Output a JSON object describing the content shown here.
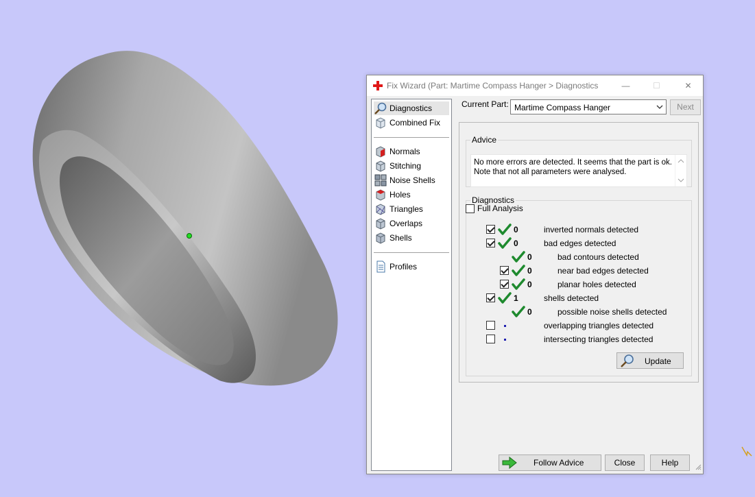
{
  "window": {
    "title": "Fix Wizard (Part: Martime Compass Hanger > Diagnostics",
    "minimize": "—",
    "maximize": "☐",
    "close": "✕"
  },
  "sidebar": {
    "items": [
      {
        "label": "Diagnostics",
        "icon": "magnifier-icon"
      },
      {
        "label": "Combined Fix",
        "icon": "cube-icon"
      },
      {
        "label": "Normals",
        "icon": "normals-cube-icon"
      },
      {
        "label": "Stitching",
        "icon": "stitching-cube-icon"
      },
      {
        "label": "Noise Shells",
        "icon": "noise-shells-icon"
      },
      {
        "label": "Holes",
        "icon": "holes-cube-icon"
      },
      {
        "label": "Triangles",
        "icon": "triangles-cube-icon"
      },
      {
        "label": "Overlaps",
        "icon": "overlaps-cube-icon"
      },
      {
        "label": "Shells",
        "icon": "shells-cube-icon"
      },
      {
        "label": "Profiles",
        "icon": "document-icon"
      }
    ]
  },
  "header": {
    "current_part_label": "Current Part:",
    "current_part_value": "Martime Compass Hanger",
    "next_label": "Next"
  },
  "advice": {
    "legend": "Advice",
    "text": "No more errors are detected. It seems that the part is ok. Note that not all parameters were analysed."
  },
  "diagnostics": {
    "legend": "Diagnostics",
    "full_analysis_label": "Full Analysis",
    "full_analysis_checked": false,
    "rows": [
      {
        "checked": true,
        "status": "ok",
        "count": "0",
        "label": "inverted normals detected"
      },
      {
        "checked": true,
        "status": "ok",
        "count": "0",
        "label": "bad edges detected"
      },
      {
        "checked": null,
        "status": "ok",
        "count": "0",
        "label": "bad contours detected"
      },
      {
        "checked": true,
        "status": "ok",
        "count": "0",
        "label": "near bad edges detected"
      },
      {
        "checked": true,
        "status": "ok",
        "count": "0",
        "label": "planar holes detected"
      },
      {
        "checked": true,
        "status": "ok",
        "count": "1",
        "label": "shells detected"
      },
      {
        "checked": null,
        "status": "ok",
        "count": "0",
        "label": "possible noise shells detected"
      },
      {
        "checked": false,
        "status": "pending",
        "count": "",
        "label": "overlapping triangles detected"
      },
      {
        "checked": false,
        "status": "pending",
        "count": "",
        "label": "intersecting triangles detected"
      }
    ],
    "update_label": "Update"
  },
  "footer": {
    "follow_advice_label": "Follow Advice",
    "close_label": "Close",
    "help_label": "Help"
  },
  "colors": {
    "viewport_bg": "#c8c8fa",
    "check_green": "#1e8a2e",
    "dialog_bg": "#f0f0f0"
  }
}
